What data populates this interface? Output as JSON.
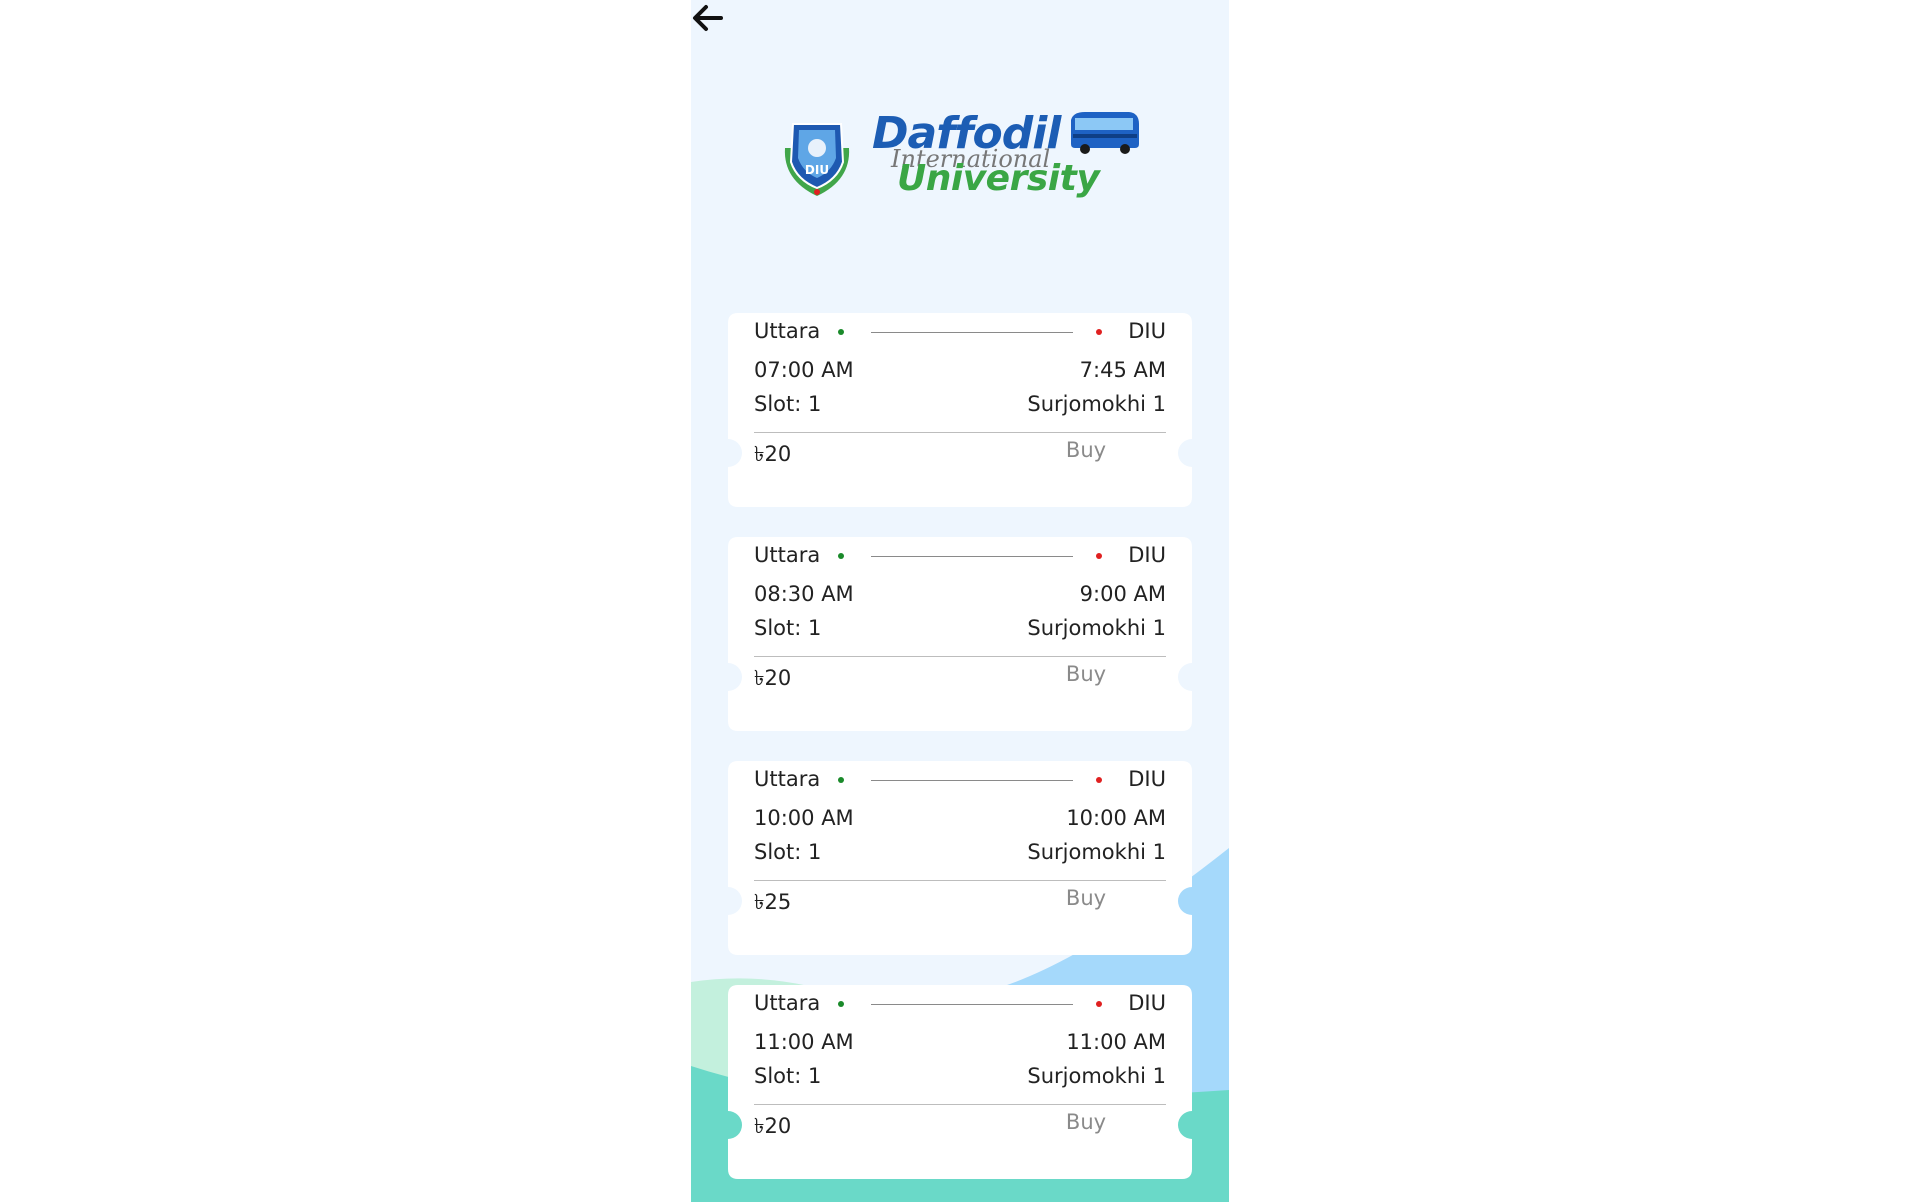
{
  "header": {
    "back_icon": "arrow-left-icon"
  },
  "logo": {
    "line1": "Daffodil",
    "line2": "International",
    "line3": "University",
    "seal_text": "DIU",
    "bus_icon": "bus-icon",
    "colors": {
      "blue": "#1c5db4",
      "green": "#3aa645",
      "gray": "#777777"
    }
  },
  "tickets": [
    {
      "from": "Uttara",
      "to": "DIU",
      "depart": "07:00 AM",
      "arrive": "7:45 AM",
      "slot": "Slot: 1",
      "bus": "Surjomokhi 1",
      "price": "৳20",
      "buy_label": "Buy"
    },
    {
      "from": "Uttara",
      "to": "DIU",
      "depart": "08:30 AM",
      "arrive": "9:00 AM",
      "slot": "Slot: 1",
      "bus": "Surjomokhi 1",
      "price": "৳20",
      "buy_label": "Buy"
    },
    {
      "from": "Uttara",
      "to": "DIU",
      "depart": "10:00 AM",
      "arrive": "10:00 AM",
      "slot": "Slot: 1",
      "bus": "Surjomokhi 1",
      "price": "৳25",
      "buy_label": "Buy"
    },
    {
      "from": "Uttara",
      "to": "DIU",
      "depart": "11:00 AM",
      "arrive": "11:00 AM",
      "slot": "Slot: 1",
      "bus": "Surjomokhi 1",
      "price": "৳20",
      "buy_label": "Buy"
    }
  ],
  "colors": {
    "page_bg": "#eef6fe",
    "origin_dot": "#1a8a2a",
    "destination_dot": "#e02020",
    "wave_teal": "#6ad9c8",
    "wave_mint": "#c3f0dd",
    "wave_blue": "#a5d9fb"
  }
}
